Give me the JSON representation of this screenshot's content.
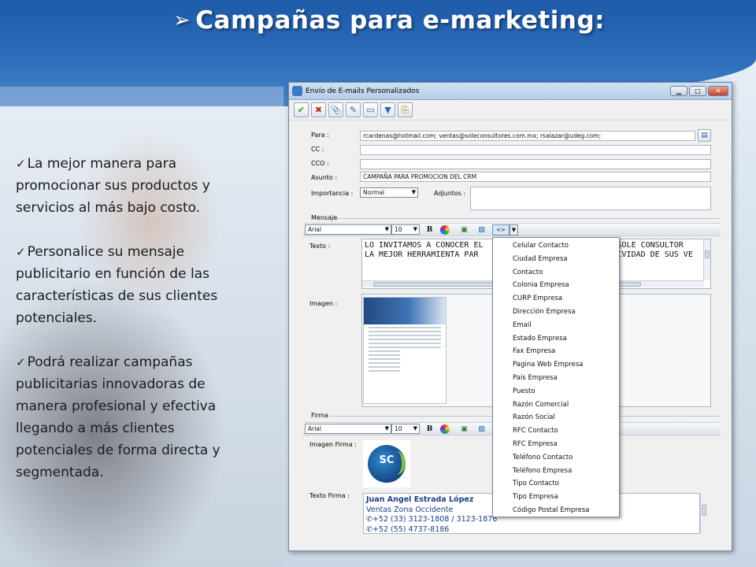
{
  "slide": {
    "title": "Campañas para e-marketing:",
    "title_arrow": "➢",
    "bullets": [
      "La mejor manera para promocionar sus productos y servicios al más bajo costo.",
      "Personalice su mensaje publicitario en función de las características de sus clientes potenciales.",
      "Podrá realizar campañas publicitarias innovadoras de manera profesional y efectiva llegando a más clientes potenciales de forma directa y segmentada."
    ]
  },
  "window": {
    "title": "Envío de E-mails Personalizados",
    "controls": {
      "minimize": "▁",
      "maximize": "□",
      "close": "✕"
    },
    "toolbar": [
      "✔",
      "✖",
      "📎",
      "✎",
      "▭",
      "▼",
      "⎘"
    ],
    "fields": {
      "para_label": "Para :",
      "para_value": "rcardenas@hotmail.com; ventas@soleconsultores.com.mx; rsalazar@udeg.com;",
      "cc_label": "CC :",
      "cc_value": "",
      "cco_label": "CCO :",
      "cco_value": "",
      "asunto_label": "Asunto :",
      "asunto_value": "CAMPAÑA PARA PROMOCION DEL CRM",
      "importancia_label": "Importancia :",
      "importancia_value": "Normal",
      "adjuntos_label": "Adjuntos :"
    },
    "mensaje": {
      "section_label": "Mensaje",
      "font": "Arial",
      "size": "10",
      "bold": "B",
      "texto_label": "Texto :",
      "texto_line1_a": "LO INVITAMOS A CONOCER EL",
      "texto_line1_b": "SOLE CONSULTOR",
      "texto_line2_a": "LA MEJOR HERRAMIENTA PAR",
      "texto_line2_b": "TIVIDAD DE SUS VE",
      "imagen_label": "Imagen :",
      "tag_button": "<>"
    },
    "firma": {
      "section_label": "Firma",
      "font": "Arial",
      "size": "10",
      "bold": "B",
      "imagen_label": "Imagen Firma :",
      "texto_label": "Texto Firma :",
      "logo_text": "SC",
      "sig_name": "Juan Angel Estrada López",
      "sig_line2": "Ventas Zona Occidente",
      "sig_line3": "✆+52 (33) 3123-1808 / 3123-1876",
      "sig_line4": "✆+52 (55) 4737-8186"
    },
    "dropdown_items": [
      "Celular Contacto",
      "Ciudad Empresa",
      "Contacto",
      "Colonia Empresa",
      "CURP Empresa",
      "Dirección Empresa",
      "Email",
      "Estado Empresa",
      "Fax Empresa",
      "Pagina Web Empresa",
      "País Empresa",
      "Puesto",
      "Razón Comercial",
      "Razón Social",
      "RFC Contacto",
      "RFC Empresa",
      "Teléfono Contacto",
      "Teléfono Empresa",
      "Tipo Contacto",
      "Tipo Empresa",
      "Código Postal Empresa"
    ]
  }
}
